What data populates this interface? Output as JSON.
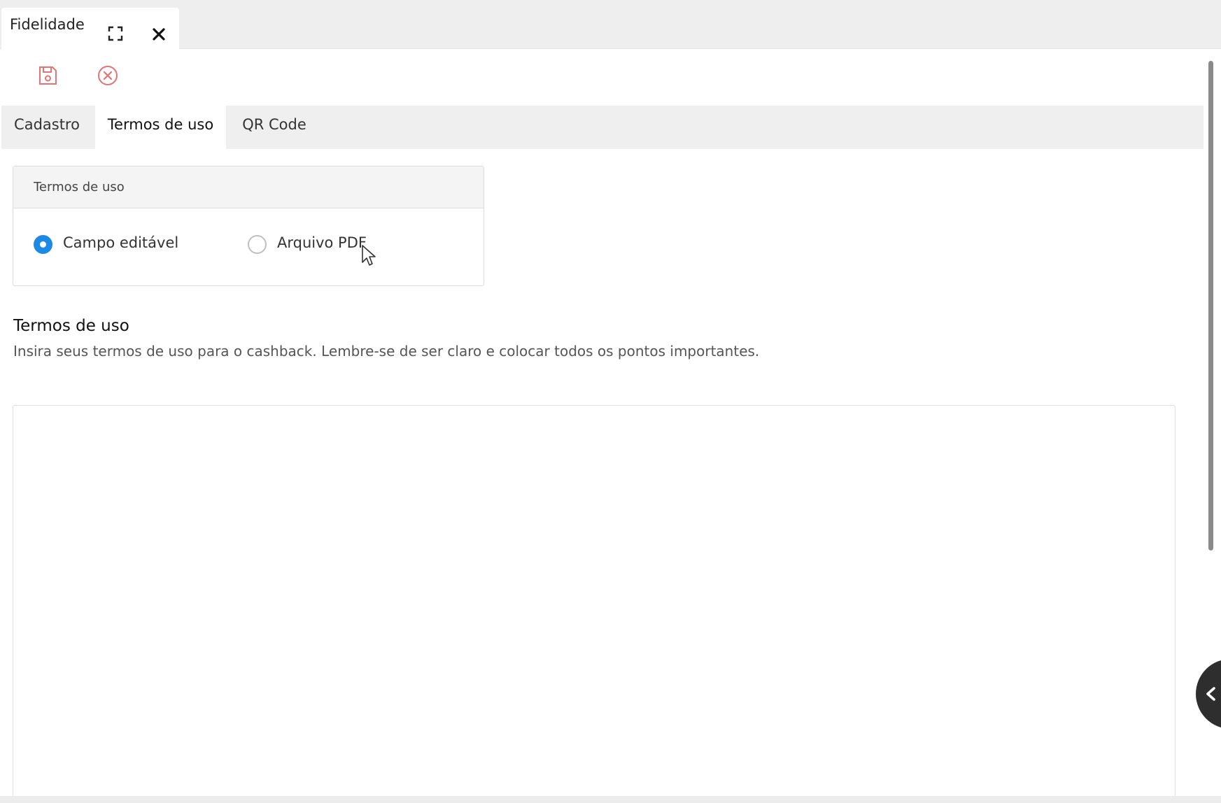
{
  "window": {
    "tab_title": "Fidelidade",
    "icons": {
      "expand": "expand-icon",
      "close": "close-icon"
    }
  },
  "toolbar": {
    "icons": {
      "save": "save-icon",
      "cancel": "cancel-icon"
    },
    "accent_color": "#e57373"
  },
  "tabs": [
    {
      "label": "Cadastro",
      "active": false
    },
    {
      "label": "Termos de uso",
      "active": true
    },
    {
      "label": "QR Code",
      "active": false
    }
  ],
  "terms_type": {
    "title": "Termos de uso",
    "options": [
      {
        "label": "Campo editável",
        "checked": true
      },
      {
        "label": "Arquivo PDF",
        "checked": false
      }
    ],
    "selected_color": "#1e88e5"
  },
  "terms_section": {
    "title": "Termos de uso",
    "description": "Insira seus termos de uso para o cashback. Lembre-se de ser claro e colocar todos os pontos importantes."
  },
  "side_toggle": {
    "icon": "chevron-left-icon"
  }
}
